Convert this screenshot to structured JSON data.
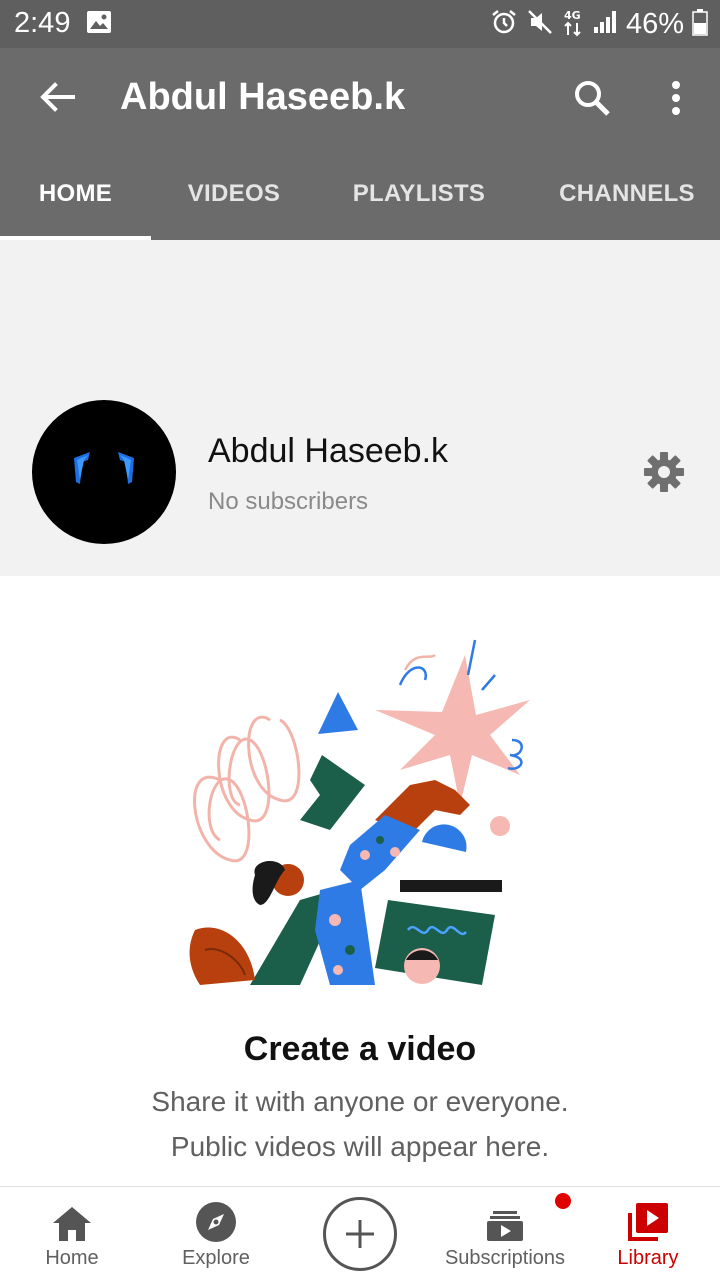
{
  "status_bar": {
    "time": "2:49",
    "battery": "46%",
    "network": "4G"
  },
  "app_bar": {
    "title": "Abdul Haseeb.k"
  },
  "tabs": [
    {
      "label": "HOME",
      "active": true
    },
    {
      "label": "VIDEOS",
      "active": false
    },
    {
      "label": "PLAYLISTS",
      "active": false
    },
    {
      "label": "CHANNELS",
      "active": false
    }
  ],
  "channel": {
    "name": "Abdul Haseeb.k",
    "subscribers": "No subscribers"
  },
  "empty_state": {
    "title": "Create a video",
    "line1": "Share it with anyone or everyone.",
    "line2": "Public videos will appear here."
  },
  "bottom_nav": {
    "items": [
      {
        "label": "Home",
        "icon": "home-icon"
      },
      {
        "label": "Explore",
        "icon": "compass-icon"
      },
      {
        "label": "",
        "icon": "create-plus-icon"
      },
      {
        "label": "Subscriptions",
        "icon": "subscriptions-icon"
      },
      {
        "label": "Library",
        "icon": "library-icon",
        "active": true
      }
    ]
  },
  "colors": {
    "header_gray": "#6b6b6b",
    "status_gray": "#5f5f5f",
    "accent_red": "#cc0000",
    "banner_bg": "#f2f2f2"
  }
}
